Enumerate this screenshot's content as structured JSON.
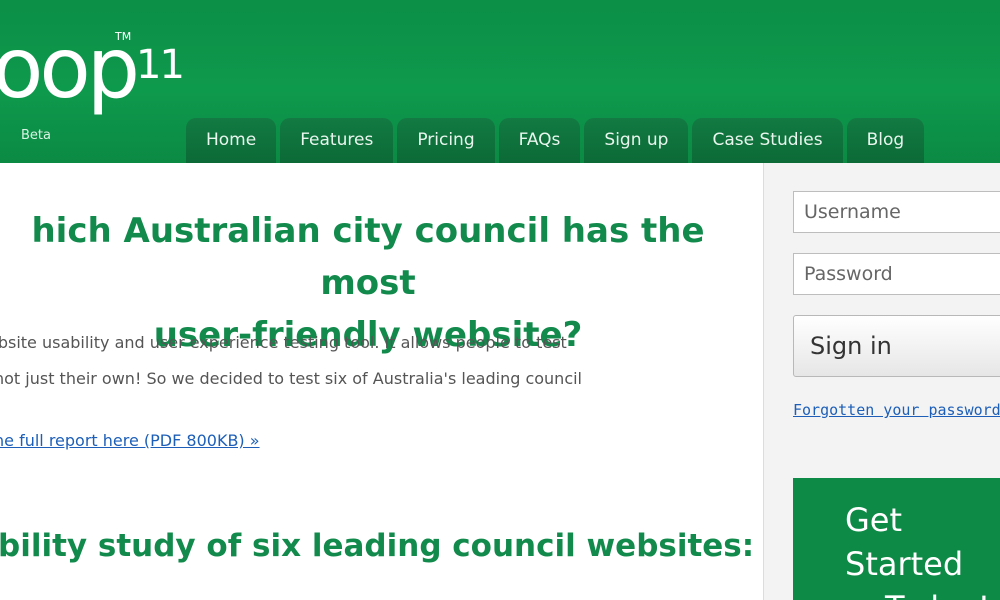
{
  "brand": {
    "logo_text": "oop",
    "logo_tm": "TM",
    "logo_number": "11",
    "logo_tagline": "Beta",
    "colors": {
      "header_green": "#0e9a4d",
      "tab_green": "#0c6a37",
      "heading_green": "#128a4c",
      "link_blue": "#1d5fb8"
    }
  },
  "nav": {
    "tabs": [
      {
        "label": "Home"
      },
      {
        "label": "Features"
      },
      {
        "label": "Pricing"
      },
      {
        "label": "FAQs"
      },
      {
        "label": "Sign up"
      },
      {
        "label": "Case Studies"
      },
      {
        "label": "Blog"
      }
    ]
  },
  "main": {
    "headline_line1": "hich Australian city council has the most",
    "headline_line2": "user-friendly website?",
    "intro_line1": "a website usability and user experience testing tool. It allows people to test",
    "intro_line2": "site not just their own! So we decided to test six of Australia's leading council",
    "intro_line3": ".",
    "report_link": "he full report here (PDF 800KB) »",
    "subheading": "bility study of six leading council websites:"
  },
  "login": {
    "username_placeholder": "Username",
    "password_placeholder": "Password",
    "signin_label": "Sign in",
    "forgot_label": "Forgotten your password?"
  },
  "cta": {
    "line1": "Get Started",
    "line2": "Today!"
  }
}
